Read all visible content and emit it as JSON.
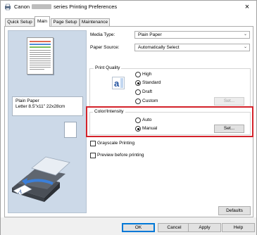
{
  "window": {
    "title_prefix": "Canon",
    "title_suffix": "series Printing Preferences",
    "close_glyph": "×"
  },
  "tabs": [
    {
      "label": "Quick Setup"
    },
    {
      "label": "Main"
    },
    {
      "label": "Page Setup"
    },
    {
      "label": "Maintenance"
    }
  ],
  "active_tab": "Main",
  "preview": {
    "paper_name": "Plain Paper",
    "paper_size": "Letter 8.5\"x11\" 22x28cm"
  },
  "main": {
    "media_type_label": "Media Type:",
    "media_type_value": "Plain Paper",
    "paper_source_label": "Paper Source:",
    "paper_source_value": "Automatically Select",
    "print_quality": {
      "title": "Print Quality",
      "options": [
        "High",
        "Standard",
        "Draft",
        "Custom"
      ],
      "selected": "Standard",
      "set_button": "Set..."
    },
    "color_intensity": {
      "title": "Color/Intensity",
      "options": [
        "Auto",
        "Manual"
      ],
      "selected": "Manual",
      "set_button": "Set..."
    },
    "grayscale_label": "Grayscale Printing",
    "preview_label": "Preview before printing",
    "defaults_button": "Defaults"
  },
  "footer": {
    "ok": "OK",
    "cancel": "Cancel",
    "apply": "Apply",
    "help": "Help"
  },
  "colors": {
    "highlight": "#d4222a",
    "preview_bg": "#ccd9e8",
    "default_button_border": "#0078d7"
  },
  "icons": [
    "printer-app-icon",
    "close-icon",
    "chevron-down-icon",
    "print-quality-letter-icon",
    "printer-illustration"
  ]
}
